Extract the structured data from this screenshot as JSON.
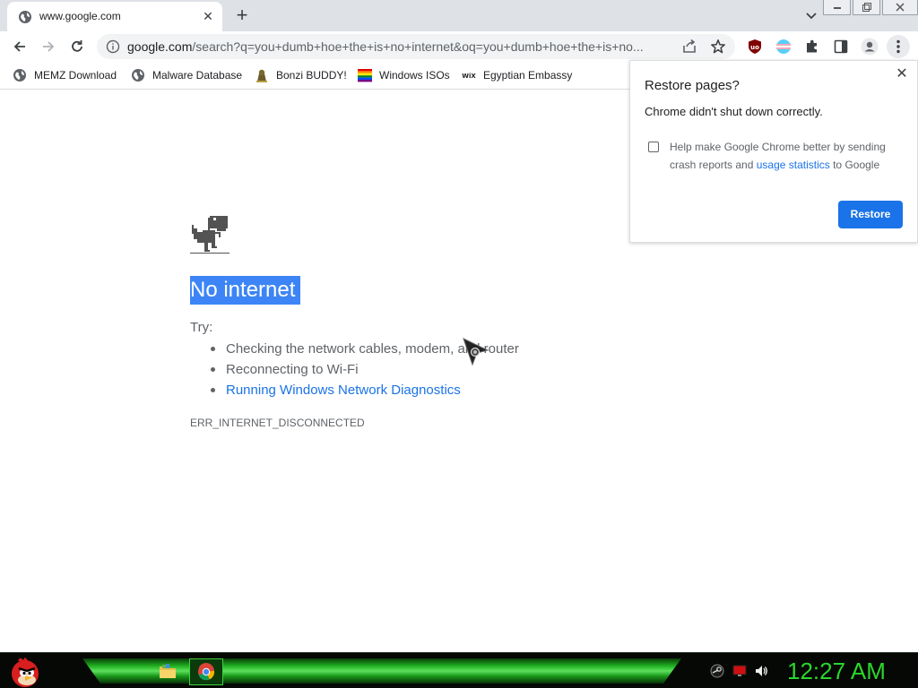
{
  "tab": {
    "title": "www.google.com",
    "close_glyph": "✕"
  },
  "newtab_glyph": "+",
  "window_controls": [
    "minimize",
    "restore",
    "close"
  ],
  "omnibox": {
    "url_host": "google.com",
    "url_rest": "/search?q=you+dumb+hoe+the+is+no+internet&oq=you+dumb+hoe+the+is+no..."
  },
  "bookmarks": [
    {
      "label": "MEMZ Download",
      "icon": "globe-icon"
    },
    {
      "label": "Malware Database",
      "icon": "globe-icon"
    },
    {
      "label": "Bonzi BUDDY!",
      "icon": "bonzi-icon"
    },
    {
      "label": "Windows ISOs",
      "icon": "rainbow-flag-icon"
    },
    {
      "label": "Egyptian Embassy",
      "icon": "wix-icon"
    }
  ],
  "error": {
    "title": "No internet",
    "try_label": "Try:",
    "suggestions": [
      "Checking the network cables, modem, and router",
      "Reconnecting to Wi-Fi",
      "Running Windows Network Diagnostics"
    ],
    "code": "ERR_INTERNET_DISCONNECTED"
  },
  "popup": {
    "title": "Restore pages?",
    "message": "Chrome didn't shut down correctly.",
    "help_pre": "Help make Google Chrome better by sending crash reports and ",
    "help_link": "usage statistics",
    "help_post": " to Google",
    "restore_label": "Restore",
    "close_glyph": "✕"
  },
  "taskbar": {
    "clock": "12:27 AM",
    "apps": [
      "file-explorer-icon",
      "chrome-icon"
    ],
    "tray": [
      "steam-icon",
      "monitor-icon",
      "volume-icon"
    ]
  },
  "colors": {
    "accent": "#1a73e8",
    "selection": "#3d85f6",
    "clock": "#2bd62b"
  }
}
